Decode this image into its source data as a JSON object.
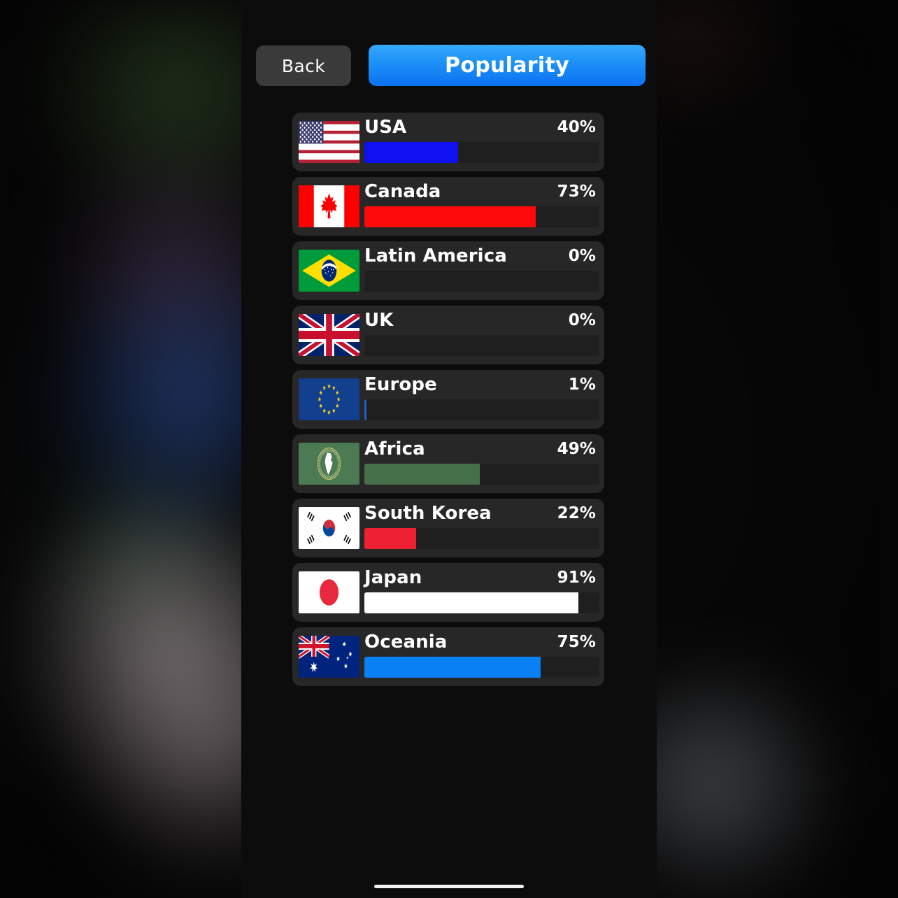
{
  "header": {
    "back_label": "Back",
    "title": "Popularity",
    "title_gradient_top": "#36a9fa",
    "title_gradient_bottom": "#0c71f1",
    "back_bg": "#3a3a3a"
  },
  "theme": {
    "screen_bg": "#0c0c0c",
    "row_bg": "#272727",
    "track_bg": "#1f1f1f",
    "text": "#ffffff"
  },
  "chart_data": {
    "type": "bar",
    "title": "Popularity",
    "xlabel": "",
    "ylabel": "",
    "ylim": [
      0,
      100
    ],
    "orientation": "horizontal",
    "grid": false,
    "legend": "none",
    "value_suffix": "%",
    "categories": [
      "USA",
      "Canada",
      "Latin America",
      "UK",
      "Europe",
      "Africa",
      "South Korea",
      "Japan",
      "Oceania"
    ],
    "values": [
      40,
      73,
      0,
      0,
      1,
      49,
      22,
      91,
      75
    ]
  },
  "rows": [
    {
      "name": "USA",
      "percent_label": "40%",
      "value": 40,
      "flag": "flag-usa",
      "bar_color": "#1010f0"
    },
    {
      "name": "Canada",
      "percent_label": "73%",
      "value": 73,
      "flag": "flag-canada",
      "bar_color": "#ff0a0a"
    },
    {
      "name": "Latin America",
      "percent_label": "0%",
      "value": 0,
      "flag": "flag-brazil",
      "bar_color": "#27a536"
    },
    {
      "name": "UK",
      "percent_label": "0%",
      "value": 0,
      "flag": "flag-uk",
      "bar_color": "#1d44a8"
    },
    {
      "name": "Europe",
      "percent_label": "1%",
      "value": 1,
      "flag": "flag-europe",
      "bar_color": "#1b5fd0"
    },
    {
      "name": "Africa",
      "percent_label": "49%",
      "value": 49,
      "flag": "flag-african-union",
      "bar_color": "#46704a"
    },
    {
      "name": "South Korea",
      "percent_label": "22%",
      "value": 22,
      "flag": "flag-south-korea",
      "bar_color": "#ec2132"
    },
    {
      "name": "Japan",
      "percent_label": "91%",
      "value": 91,
      "flag": "flag-japan",
      "bar_color": "#ffffff"
    },
    {
      "name": "Oceania",
      "percent_label": "75%",
      "value": 75,
      "flag": "flag-australia",
      "bar_color": "#0a80f5"
    }
  ]
}
